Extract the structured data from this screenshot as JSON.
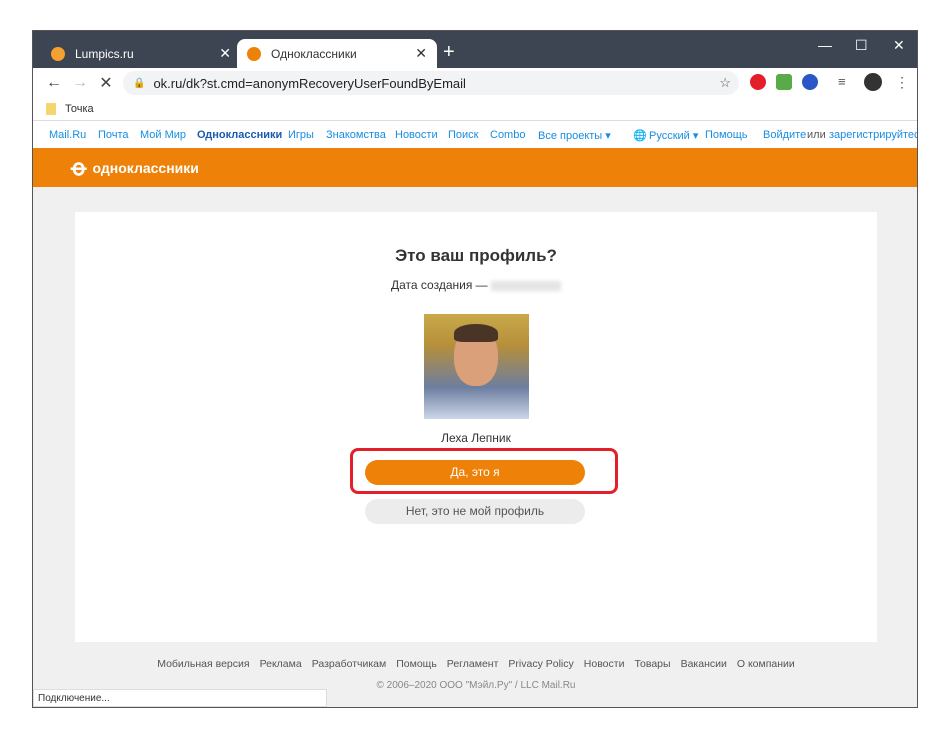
{
  "browser": {
    "tabs": [
      {
        "title": "Lumpics.ru",
        "favicon_color": "#f5a030"
      },
      {
        "title": "Одноклассники",
        "favicon_color": "#ee8208",
        "active": true
      }
    ],
    "url": "ok.ru/dk?st.cmd=anonymRecoveryUserFoundByEmail",
    "bookmark": "Точка",
    "status": "Подключение..."
  },
  "mailbar": {
    "items": [
      "Mail.Ru",
      "Почта",
      "Мой Мир",
      "Одноклассники",
      "Игры",
      "Знакомства",
      "Новости",
      "Поиск",
      "Combo",
      "Все проекты ▾"
    ],
    "lang": "Русский ▾",
    "help": "Помощь",
    "login": "Войдите",
    "or": "или",
    "register": "зарегистрируйтесь"
  },
  "ok": {
    "logo_text": "одноклассники",
    "brand_color": "#ee8208"
  },
  "card": {
    "title": "Это ваш профиль?",
    "date_label": "Дата создания —",
    "name": "Леха Лепник",
    "yes": "Да, это я",
    "no": "Нет, это не мой профиль"
  },
  "footer": {
    "links": [
      "Мобильная версия",
      "Реклама",
      "Разработчикам",
      "Помощь",
      "Регламент",
      "Privacy Policy",
      "Новости",
      "Товары",
      "Вакансии",
      "О компании"
    ],
    "copyright": "© 2006–2020 ООО \"Мэйл.Ру\" / LLC Mail.Ru"
  }
}
